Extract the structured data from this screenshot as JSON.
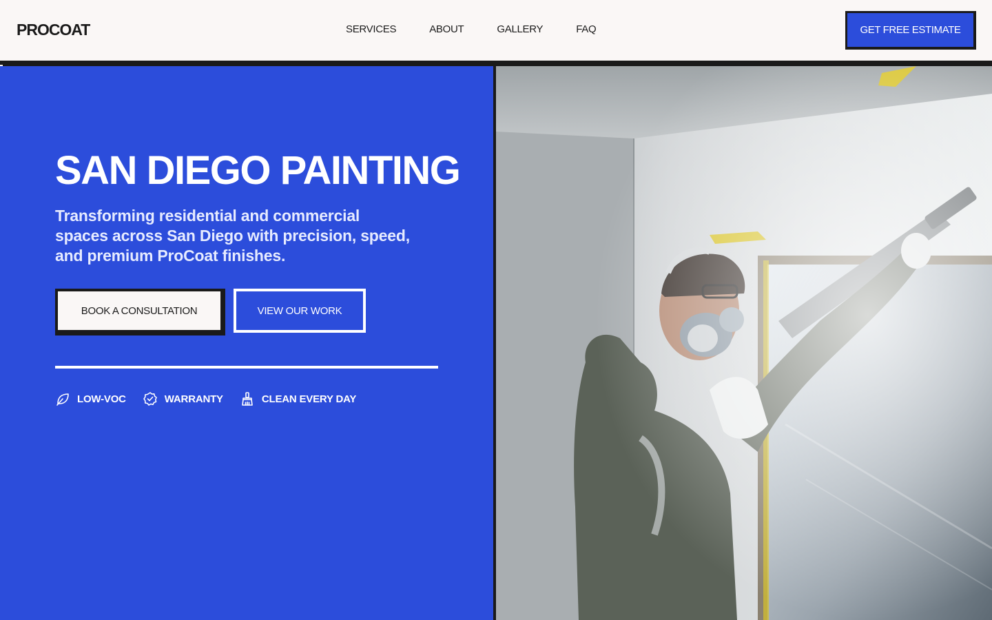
{
  "header": {
    "logo": "PROCOAT",
    "nav": [
      "SERVICES",
      "ABOUT",
      "GALLERY",
      "FAQ"
    ],
    "cta_label": "GET FREE ESTIMATE"
  },
  "hero": {
    "title": "SAN DIEGO PAINTING",
    "subtitle": "Transforming residential and commercial spaces across San Diego with precision, speed, and premium ProCoat finishes.",
    "primary_button": "BOOK A CONSULTATION",
    "secondary_button": "VIEW OUR WORK",
    "features": [
      {
        "icon": "leaf-icon",
        "label": "LOW-VOC"
      },
      {
        "icon": "badge-check-icon",
        "label": "WARRANTY"
      },
      {
        "icon": "brush-icon",
        "label": "CLEAN EVERY DAY"
      }
    ]
  },
  "image": {
    "subject": "painter-spraying-icon"
  },
  "colors": {
    "brand_blue": "#2c4ddb",
    "ink": "#1a1a1a",
    "paper": "#faf7f6"
  }
}
